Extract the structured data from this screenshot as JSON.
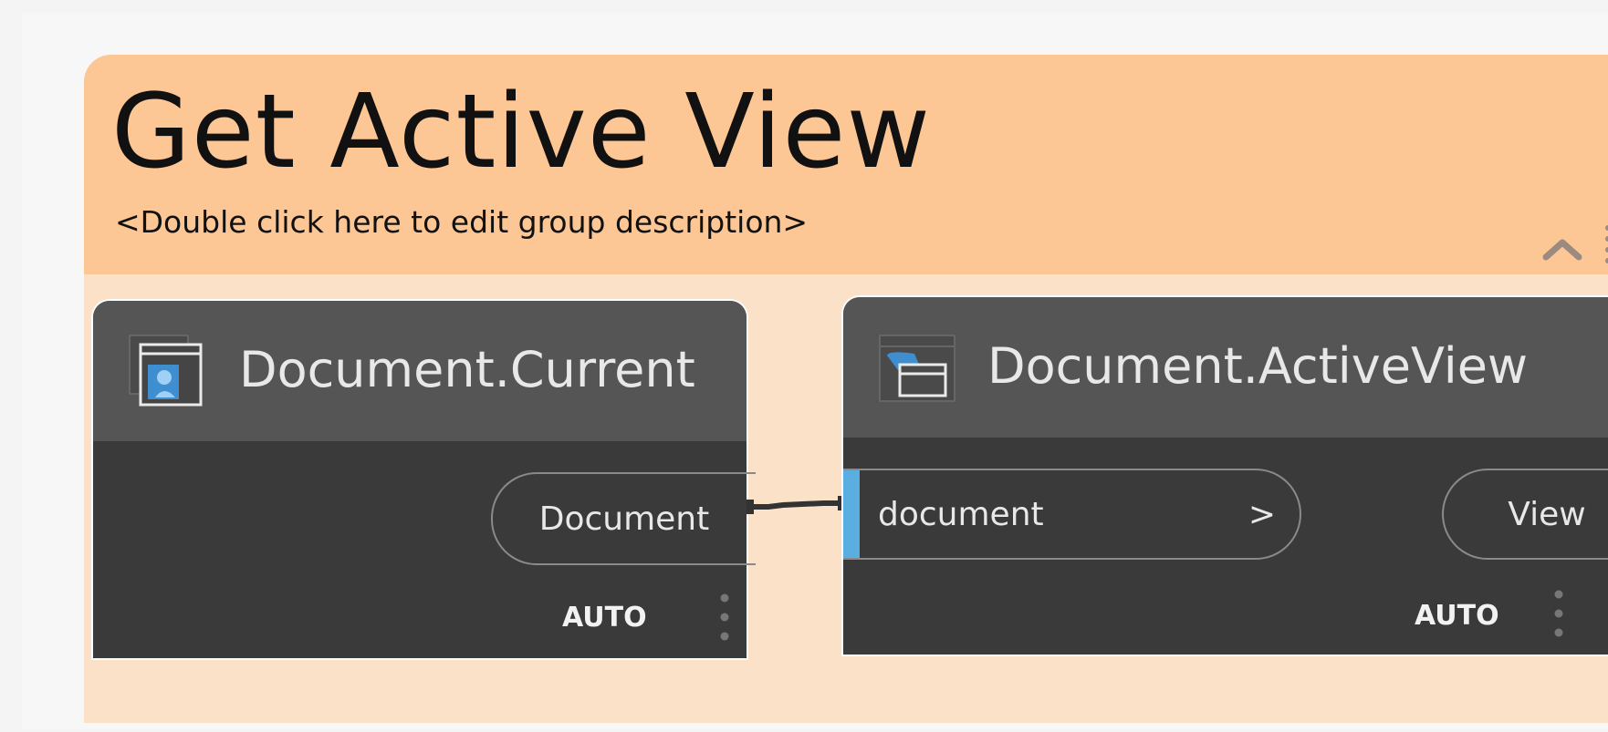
{
  "group": {
    "title": "Get Active View",
    "description": "<Double click here to edit group description>",
    "header_color": "#fdc695",
    "body_color": "#fbe1c8"
  },
  "nodes": [
    {
      "title": "Document.Current",
      "icon": "document-current-icon",
      "outputs": [
        {
          "label": "Document"
        }
      ],
      "lacing": "AUTO"
    },
    {
      "title": "Document.ActiveView",
      "icon": "document-activeview-icon",
      "inputs": [
        {
          "label": "document",
          "arrow": ">"
        }
      ],
      "outputs": [
        {
          "label": "View"
        }
      ],
      "lacing": "AUTO"
    }
  ],
  "colors": {
    "node_header": "#555555",
    "node_body": "#3a3a3a",
    "input_accent": "#5aaee0",
    "text": "#e8e8e8"
  }
}
